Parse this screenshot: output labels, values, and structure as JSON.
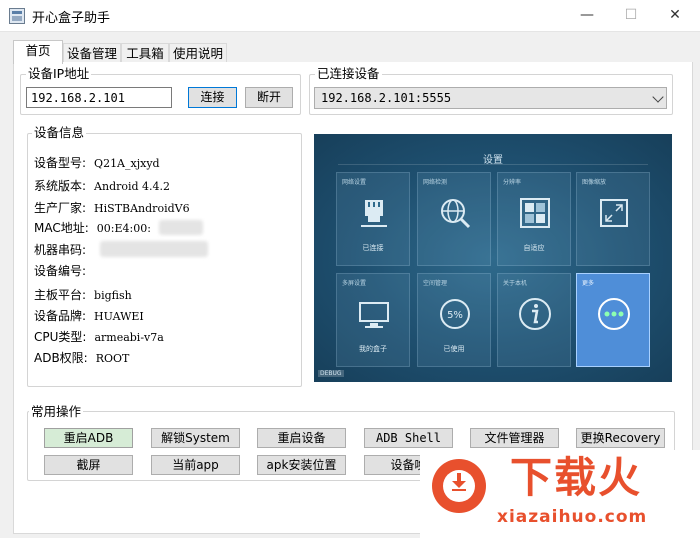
{
  "window": {
    "title": "开心盒子助手",
    "minimize": "—",
    "maximize": "☐",
    "close": "✕"
  },
  "tabs": [
    {
      "label": "首页"
    },
    {
      "label": "设备管理"
    },
    {
      "label": "工具箱"
    },
    {
      "label": "使用说明"
    }
  ],
  "ip_group": {
    "title": "设备IP地址",
    "ip_value": "192.168.2.101",
    "connect_label": "连接",
    "disconnect_label": "断开"
  },
  "connected_group": {
    "title": "已连接设备",
    "selected": "192.168.2.101:5555"
  },
  "device_info": {
    "title": "设备信息",
    "rows": [
      {
        "key": "设备型号:",
        "value": "Q21A_xjxyd"
      },
      {
        "key": "系统版本:",
        "value": "Android 4.4.2"
      },
      {
        "key": "生产厂家:",
        "value": "HiSTBAndroidV6"
      },
      {
        "key": "MAC地址:",
        "value": "00:E4:00:"
      },
      {
        "key": "机器串码:",
        "value": ""
      },
      {
        "key": "设备编号:",
        "value": ""
      },
      {
        "key": "主板平台:",
        "value": "bigfish"
      },
      {
        "key": "设备品牌:",
        "value": "HUAWEI"
      },
      {
        "key": "CPU类型:",
        "value": "armeabi-v7a"
      },
      {
        "key": "ADB权限:",
        "value": "ROOT"
      }
    ]
  },
  "screen": {
    "title": "设置",
    "debug": "DEBUG",
    "tiles": [
      {
        "top": "网络设置",
        "bottom": "已连接",
        "icon": "ethernet-icon"
      },
      {
        "top": "网络检测",
        "bottom": "",
        "icon": "globe-search-icon"
      },
      {
        "top": "分辨率",
        "bottom": "自适应",
        "icon": "resolution-grid-icon"
      },
      {
        "top": "图像缩放",
        "bottom": "",
        "icon": "scale-arrows-icon"
      },
      {
        "top": "多屏设置",
        "bottom": "我的盒子",
        "icon": "monitor-icon"
      },
      {
        "top": "空间管理",
        "bottom": "已使用",
        "icon": "storage-ring-icon",
        "ring": "5%"
      },
      {
        "top": "关于本机",
        "bottom": "",
        "icon": "info-icon"
      },
      {
        "top": "更多",
        "bottom": "",
        "icon": "more-dots-icon"
      }
    ]
  },
  "operations": {
    "title": "常用操作",
    "row1": [
      "重启ADB",
      "解锁System",
      "重启设备",
      "ADB Shell",
      "文件管理器",
      "更换Recovery"
    ],
    "row2": [
      "截屏",
      "当前app",
      "apk安装位置",
      "设备唤"
    ]
  },
  "watermark": {
    "brand": "下载火",
    "url": "xiazaihuo.com"
  },
  "colors": {
    "accent": "#0078d7",
    "tv_bg": "#1d4e6f",
    "tile_selected": "#4f8ed8",
    "watermark": "#e8502d"
  }
}
